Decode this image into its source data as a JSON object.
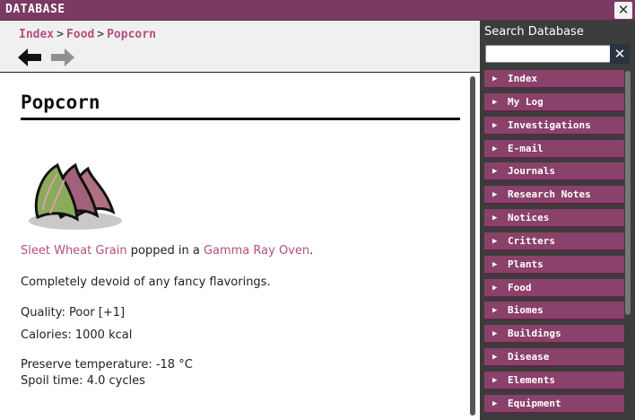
{
  "window": {
    "title": "DATABASE",
    "close_label": "✕"
  },
  "breadcrumb": [
    {
      "label": "Index"
    },
    {
      "label": "Food"
    },
    {
      "label": "Popcorn"
    }
  ],
  "breadcrumb_separator": ">",
  "article": {
    "title": "Popcorn",
    "recipe": {
      "ingredient": "Sleet Wheat Grain",
      "middle_text": " popped in a ",
      "station": "Gamma Ray Oven",
      "end_text": "."
    },
    "description": "Completely devoid of any fancy flavorings.",
    "quality": "Quality: Poor [+1]",
    "calories": "Calories: 1000 kcal",
    "preserve_temperature": "Preserve temperature: -18 °C",
    "spoil_time": "Spoil time: 4.0 cycles"
  },
  "search": {
    "label": "Search Database",
    "value": "",
    "placeholder": "",
    "clear_label": "✕"
  },
  "categories": [
    "Index",
    "My Log",
    "Investigations",
    "E-mail",
    "Journals",
    "Research Notes",
    "Notices",
    "Critters",
    "Plants",
    "Food",
    "Biomes",
    "Buildings",
    "Disease",
    "Elements",
    "Equipment"
  ],
  "colors": {
    "accent": "#b5507e",
    "titlebar": "#7a3a63",
    "category": "#8a416a"
  },
  "icons": {
    "back": "arrow-left-icon",
    "forward": "arrow-right-icon",
    "expand": "triangle-right-icon"
  }
}
